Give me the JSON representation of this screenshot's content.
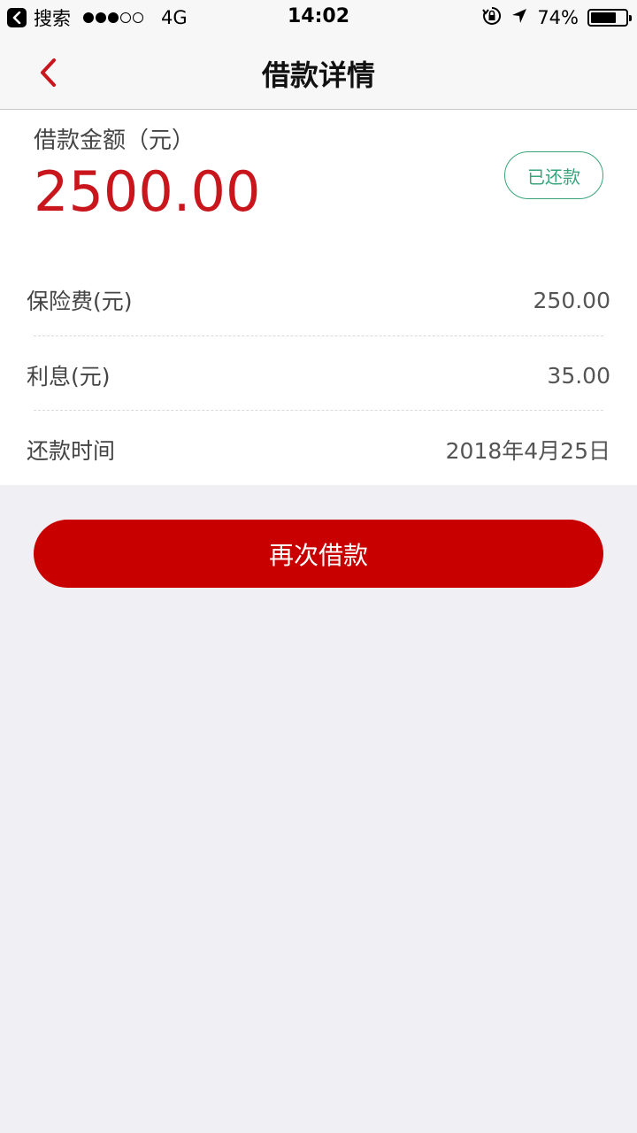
{
  "status_bar": {
    "back_app": "搜索",
    "carrier": "4G",
    "time": "14:02",
    "battery": "74%",
    "battery_level": 0.74
  },
  "nav": {
    "title": "借款详情"
  },
  "loan": {
    "amount_label": "借款金额（元）",
    "amount": "2500.00",
    "status": "已还款"
  },
  "details": [
    {
      "label": "保险费(元)",
      "value": "250.00"
    },
    {
      "label": "利息(元)",
      "value": "35.00"
    },
    {
      "label": "还款时间",
      "value": "2018年4月25日"
    }
  ],
  "actions": {
    "again_label": "再次借款"
  },
  "colors": {
    "accent_red": "#c9161d",
    "button_red": "#c90000",
    "status_green": "#3aa57a"
  }
}
